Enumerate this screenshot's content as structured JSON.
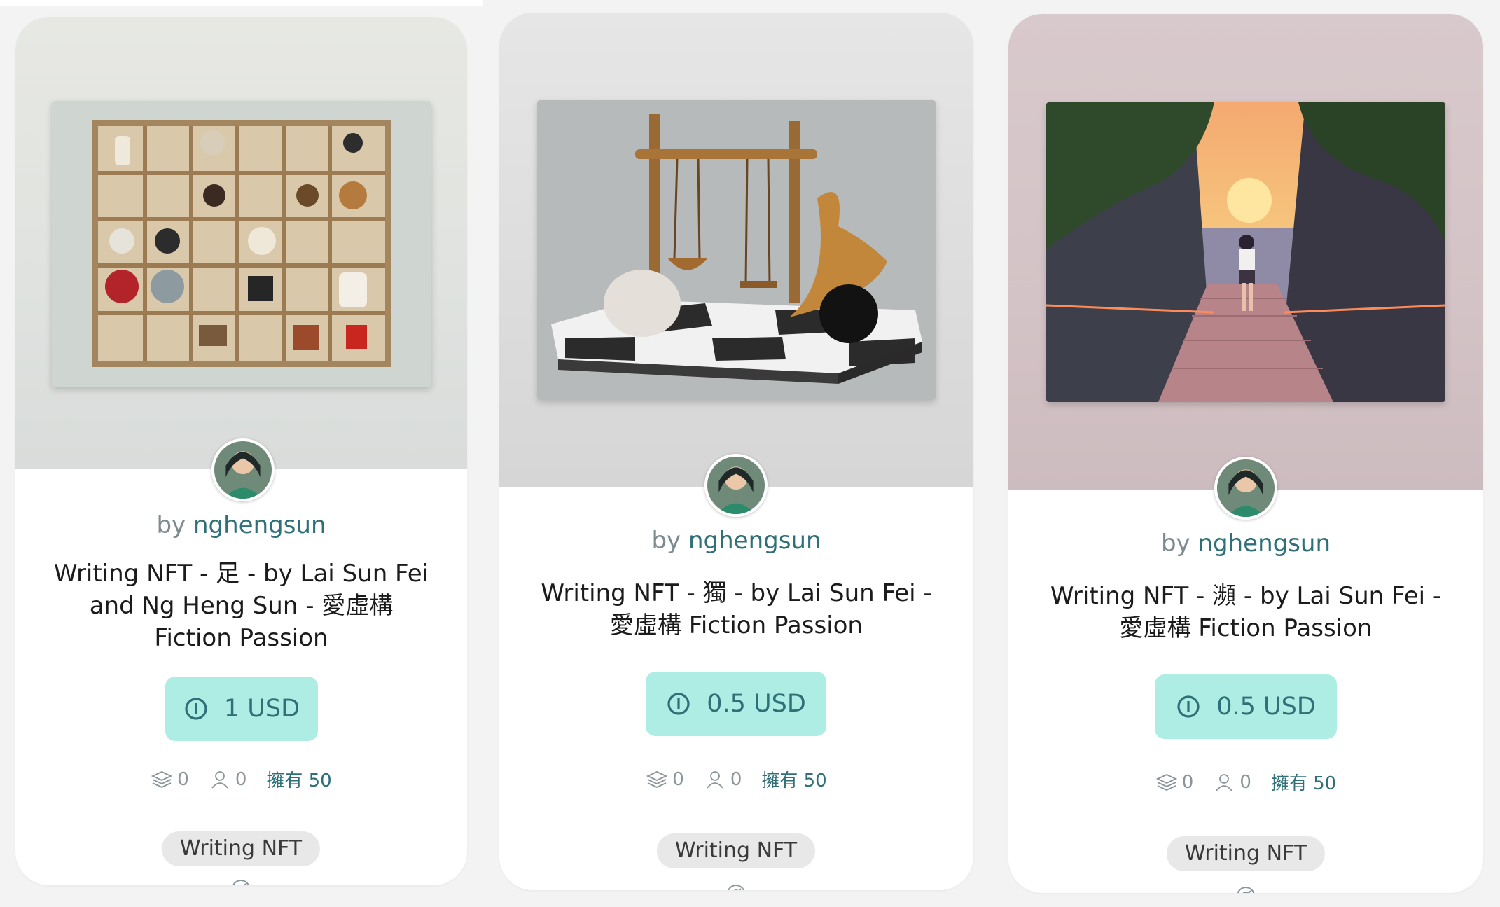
{
  "cards": [
    {
      "by_label": "by",
      "author": "nghengsun",
      "title": "Writing NFT - 足 - by Lai Sun Fei and Ng Heng Sun - 愛虛構 Fiction Passion",
      "price": "1 USD",
      "stat_layers": "0",
      "stat_people": "0",
      "owned": "擁有 50",
      "tag": "Writing NFT",
      "artwork_icon": "shadow-box-artwork"
    },
    {
      "by_label": "by",
      "author": "nghengsun",
      "title": "Writing NFT - 獨 - by Lai Sun Fei - 愛虛構 Fiction Passion",
      "price": "0.5 USD",
      "stat_layers": "0",
      "stat_people": "0",
      "owned": "擁有 50",
      "tag": "Writing NFT",
      "artwork_icon": "swing-set-artwork"
    },
    {
      "by_label": "by",
      "author": "nghengsun",
      "title": "Writing NFT - 瀕 - by Lai Sun Fei - 愛虛構 Fiction Passion",
      "price": "0.5 USD",
      "stat_layers": "0",
      "stat_people": "0",
      "owned": "擁有 50",
      "tag": "Writing NFT",
      "artwork_icon": "sunset-stairs-artwork"
    }
  ],
  "colors": {
    "accent": "#2e6f78",
    "price_bg": "#aeede3",
    "tag_bg": "#e8e8e8",
    "muted": "#8a9499"
  }
}
